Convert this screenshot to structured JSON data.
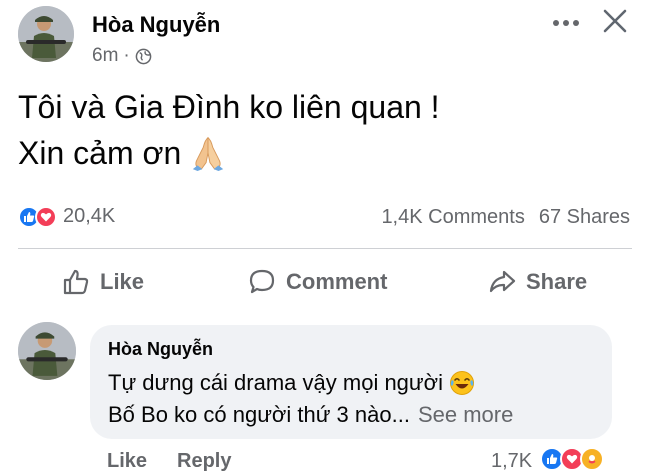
{
  "post": {
    "author": "Hòa Nguyễn",
    "time": "6m",
    "separator": "·",
    "text_line1": "Tôi và Gia Đình ko liên quan !",
    "text_line2": "Xin cảm ơn",
    "emoji": "folded-hands",
    "reaction_count": "20,4K",
    "comments_count": "1,4K Comments",
    "shares_count": "67 Shares",
    "reactions": [
      "like",
      "love"
    ]
  },
  "actions": {
    "like_label": "Like",
    "comment_label": "Comment",
    "share_label": "Share"
  },
  "comment": {
    "author": "Hòa Nguyễn",
    "text_line1": "Tự dưng cái drama vậy mọi người",
    "text_line2": "Bố Bo ko có người thứ 3 nào...",
    "see_more_label": "See more",
    "emoji": "face-with-tears-of-joy",
    "like_label": "Like",
    "reply_label": "Reply",
    "reaction_count": "1,7K",
    "reactions": [
      "like",
      "love",
      "care"
    ]
  },
  "icons": {
    "more": "more-horizontal-icon",
    "close": "close-icon",
    "privacy": "globe-icon",
    "like": "thumbs-up-icon",
    "comment": "comment-bubble-icon",
    "share": "share-arrow-icon"
  },
  "colors": {
    "like_blue": "#1877f2",
    "love_red": "#f33e58",
    "care_yellow": "#f7b125",
    "secondary_text": "#65676b",
    "bubble_bg": "#f0f2f5",
    "divider": "#ced0d4"
  }
}
